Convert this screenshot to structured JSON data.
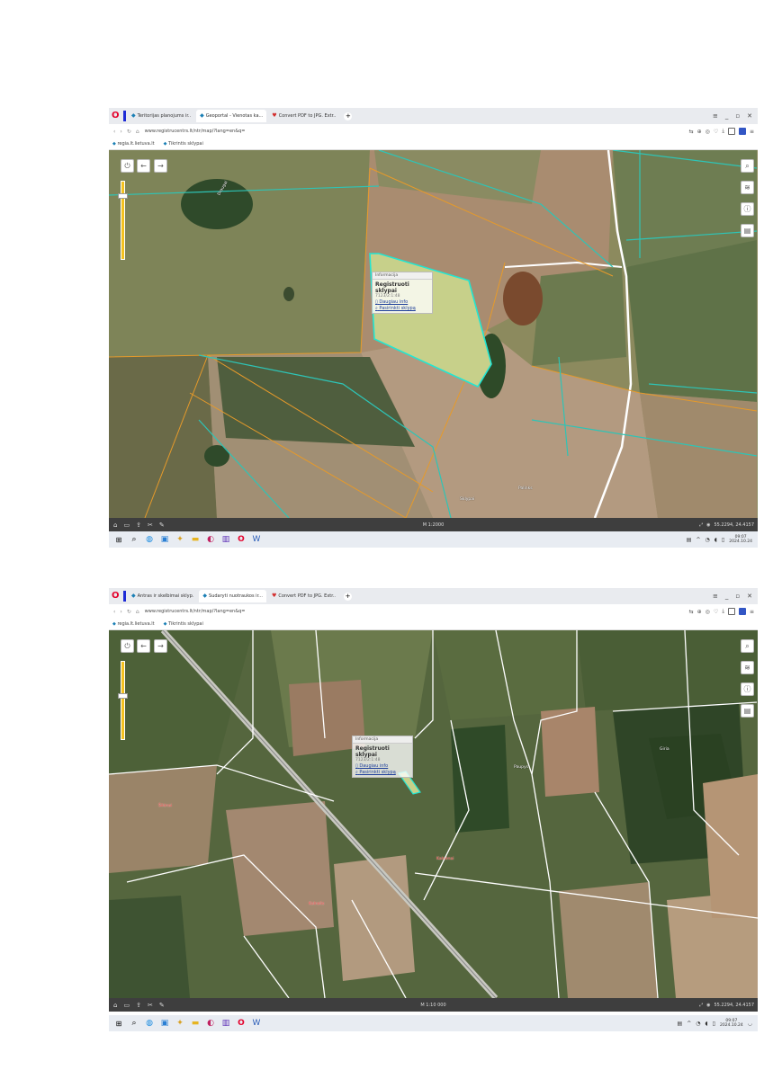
{
  "shots": [
    {
      "tabs": [
        "Teritorijas planojums ir..",
        "Geoportal - Vienotas ka...",
        "Convert PDF to JPG. Extr.."
      ],
      "url": "www.registrucentrs.lt/ntr/map/?lang=en&q=",
      "bookmarks": [
        "regia.lt.lietuva.lt",
        "Tikrintis sklypai"
      ],
      "popup": {
        "header": "Informacija",
        "title": "Registruoti sklypai",
        "number": "7123/2:1:48",
        "link1": "Daugiau info",
        "link2": "Pasirinkti sklypą"
      },
      "map_labels": [
        "Draugai",
        "Sklypai",
        "Palinks"
      ],
      "scale": "M 1:2000",
      "coords": "55.2294, 24.4157",
      "clock_time": "09:07",
      "clock_date": "2024.10.24"
    },
    {
      "tabs": [
        "Antras ir skelbimai sklyp.",
        "Sudaryti nuotraukos ir...",
        "Convert PDF to JPG. Extr.."
      ],
      "url": "www.registrucentrs.lt/ntr/map/?lang=en&q=",
      "bookmarks": [
        "regia.lt.lietuva.lt",
        "Tikrintis sklypai"
      ],
      "popup": {
        "header": "Informacija",
        "title": "Registruoti sklypai",
        "number": "7123/2:1:48",
        "link1": "Daugiau info",
        "link2": "Pasirinkti sklypą"
      },
      "map_labels": [
        "Šilėnai",
        "Kalnėnai",
        "Kalnalis",
        "Paupys",
        "Giria"
      ],
      "scale": "M 1:10 000",
      "coords": "55.2294, 24.4157",
      "clock_time": "09:07",
      "clock_date": "2024.10.24"
    }
  ],
  "icons": {
    "opera": "opera-logo-icon",
    "new_tab": "plus-icon",
    "home": "home-icon",
    "back": "arrow-left-icon",
    "forward": "arrow-right-icon"
  }
}
